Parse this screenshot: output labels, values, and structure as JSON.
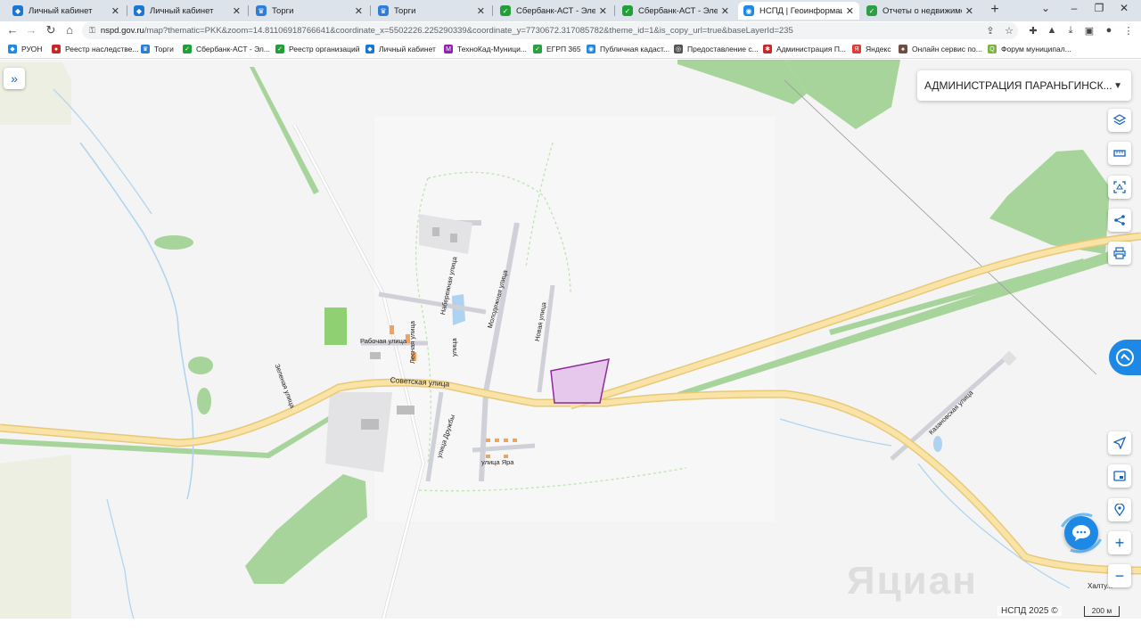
{
  "tabs": [
    {
      "title": "Личный кабинет",
      "color": "#1976d2",
      "icon": "shield-icon"
    },
    {
      "title": "Личный кабинет",
      "color": "#1976d2",
      "icon": "shield-icon"
    },
    {
      "title": "Торги",
      "color": "#2e7dd7",
      "icon": "gov-icon"
    },
    {
      "title": "Торги",
      "color": "#2e7dd7",
      "icon": "gov-icon"
    },
    {
      "title": "Сбербанк-АСТ - Электро",
      "color": "#21a038",
      "icon": "sber-icon"
    },
    {
      "title": "Сбербанк-АСТ - Электро",
      "color": "#21a038",
      "icon": "sber-icon"
    },
    {
      "title": "НСПД | Геоинформацио",
      "color": "#1e88e5",
      "icon": "nspd-icon",
      "active": true
    },
    {
      "title": "Отчеты о недвижимости",
      "color": "#2e9e44",
      "icon": "check-icon"
    }
  ],
  "address": {
    "host": "nspd.gov.ru",
    "path": "/map?thematic=PKK&zoom=14.81106918766641&coordinate_x=5502226.225290339&coordinate_y=7730672.317085782&theme_id=1&is_copy_url=true&baseLayerId=235"
  },
  "bookmarks": [
    {
      "label": "РУОН",
      "color": "#1e88e5"
    },
    {
      "label": "Реестр наследстве...",
      "color": "#c62828"
    },
    {
      "label": "Торги",
      "color": "#2e7dd7"
    },
    {
      "label": "Сбербанк-АСТ - Эл...",
      "color": "#21a038"
    },
    {
      "label": "Реестр организаций",
      "color": "#21a038"
    },
    {
      "label": "Личный кабинет",
      "color": "#1976d2"
    },
    {
      "label": "ТехноКад-Муници...",
      "color": "#8e24aa"
    },
    {
      "label": "ЕГРП 365",
      "color": "#2e9e44"
    },
    {
      "label": "Публичная кадаст...",
      "color": "#1e88e5"
    },
    {
      "label": "Предоставление с...",
      "color": "#555555"
    },
    {
      "label": "Администрация П...",
      "color": "#c62828"
    },
    {
      "label": "Яндекс",
      "color": "#e53935"
    },
    {
      "label": "Онлайн сервис по...",
      "color": "#6d4c41"
    },
    {
      "label": "Форум муниципал...",
      "color": "#7cb342"
    }
  ],
  "map": {
    "org_select": "АДМИНИСТРАЦИЯ ПАРАНЬГИНСК...",
    "copyright": "НСПД 2025 ©",
    "scale": "200 м",
    "watermark": "Яциан",
    "streets": {
      "sovetskaya": "Советская улица",
      "rabochaya": "Рабочая улица",
      "naberezhnaya": "Набережная улица",
      "molodezhnaya": "Молодежная улица",
      "novaya": "Новая улица",
      "zelenaya": "Зеленая улица",
      "druzhby": "улица Дружбы",
      "yara": "улица Яра",
      "lesnaya": "Лесная улица",
      "ulitsa_short": "улица",
      "kazanovskaya": "Казановская улица",
      "khaltu": "Халту..."
    }
  },
  "colors": {
    "road": "#f6dc95",
    "forest": "#a6d49a",
    "water": "#aed3f0",
    "parcel": "#e6c8ec",
    "parcel_border": "#8e2b9a",
    "accent": "#1e88e5"
  }
}
